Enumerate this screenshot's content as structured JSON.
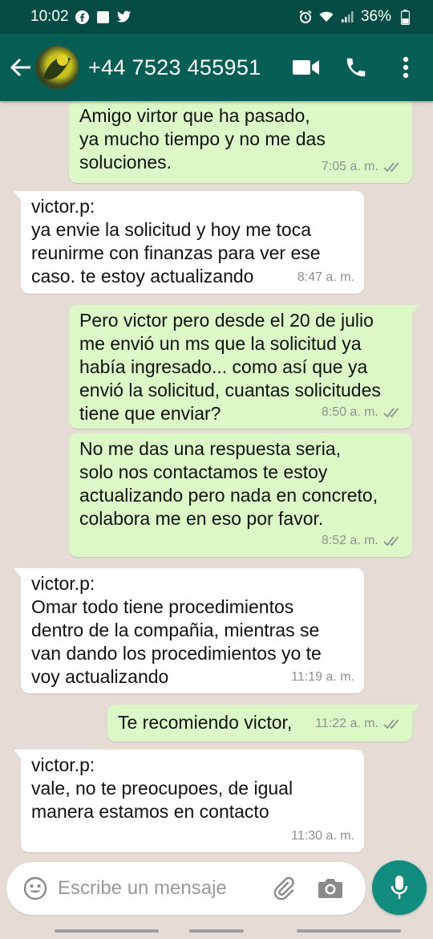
{
  "status_bar": {
    "time": "10:02",
    "battery": "36%"
  },
  "header": {
    "contact": "+44 7523 455951"
  },
  "messages": [
    {
      "dir": "out",
      "text": "Amigo virtor que ha pasado,\nya mucho tiempo y no me das\nsoluciones.",
      "time": "7:05 a. m.",
      "read": true
    },
    {
      "dir": "in",
      "text": "victor.p:\nya envie la solicitud y hoy me toca\nreunirme con finanzas para ver ese\ncaso. te estoy actualizando",
      "time": "8:47 a. m."
    },
    {
      "dir": "out",
      "text": "Pero victor pero desde el 20 de julio\nme envió un ms que la solicitud ya\nhabía ingresado... como así que ya\nenvió la solicitud, cuantas solicitudes\ntiene que enviar?",
      "time": "8:50 a. m.",
      "read": true
    },
    {
      "dir": "out",
      "text": "No me das una respuesta seria,\nsolo nos contactamos te estoy\nactualizando pero nada en concreto,\ncolabora me en eso por favor.",
      "time": "8:52 a. m.",
      "read": true
    },
    {
      "dir": "in",
      "text": "victor.p:\nOmar todo tiene procedimientos\ndentro de la compañia, mientras se\nvan dando los procedimientos yo te\nvoy actualizando",
      "time": "11:19 a. m."
    },
    {
      "dir": "out",
      "text": "Te recomiendo victor,",
      "time": "11:22 a. m.",
      "read": true
    },
    {
      "dir": "in",
      "text": "victor.p:\nvale, no te preocupoes, de igual\nmanera estamos en contacto",
      "time": "11:30 a. m."
    }
  ],
  "input": {
    "placeholder": "Escribe un mensaje"
  },
  "colors": {
    "header": "#075e54",
    "status_bar": "#054d44",
    "outgoing_bubble": "#dcf8c6",
    "incoming_bubble": "#ffffff",
    "mic_button": "#128c7e",
    "read_ticks": "#8a948d"
  },
  "icons": {
    "back": "arrow-left-icon",
    "video": "video-camera-icon",
    "call": "phone-icon",
    "menu": "more-vertical-icon",
    "emoji": "emoji-icon",
    "attach": "paperclip-icon",
    "camera": "camera-icon",
    "mic": "microphone-icon"
  }
}
